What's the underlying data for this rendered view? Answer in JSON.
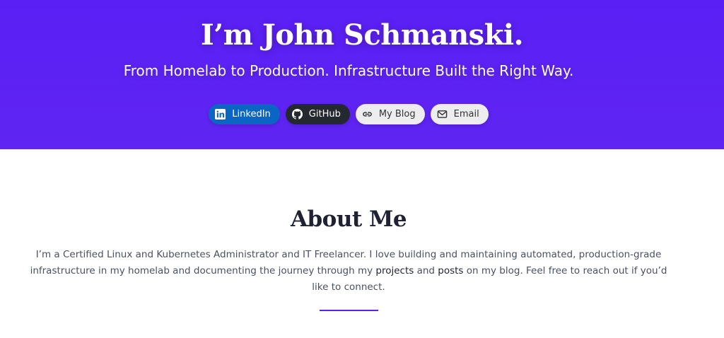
{
  "hero": {
    "title": "I’m John Schmanski.",
    "subtitle": "From Homelab to Production. Infrastructure Built the Right Way.",
    "buttons": [
      {
        "label": "LinkedIn",
        "icon": "linkedin-icon",
        "bg": "#0a66c2"
      },
      {
        "label": "GitHub",
        "icon": "github-icon",
        "bg": "#24292f"
      },
      {
        "label": "My Blog",
        "icon": "link-icon",
        "bg": "#ededf0"
      },
      {
        "label": "Email",
        "icon": "mail-icon",
        "bg": "#ededf0"
      }
    ]
  },
  "about": {
    "title": "About Me",
    "text_part1": "I’m a Certified Linux and Kubernetes Administrator and IT Freelancer. I love building and maintaining automated, production-grade infrastructure in my homelab and documenting the journey through my ",
    "projects_link": "projects",
    "text_and": " and ",
    "posts_link": "posts",
    "text_part2": " on my blog. Feel free to reach out if you’d like to connect."
  },
  "colors": {
    "hero_bg": "#5a1ff5",
    "accent": "#5b21f3",
    "heading": "#1f2233",
    "body_text": "#4a5060"
  }
}
